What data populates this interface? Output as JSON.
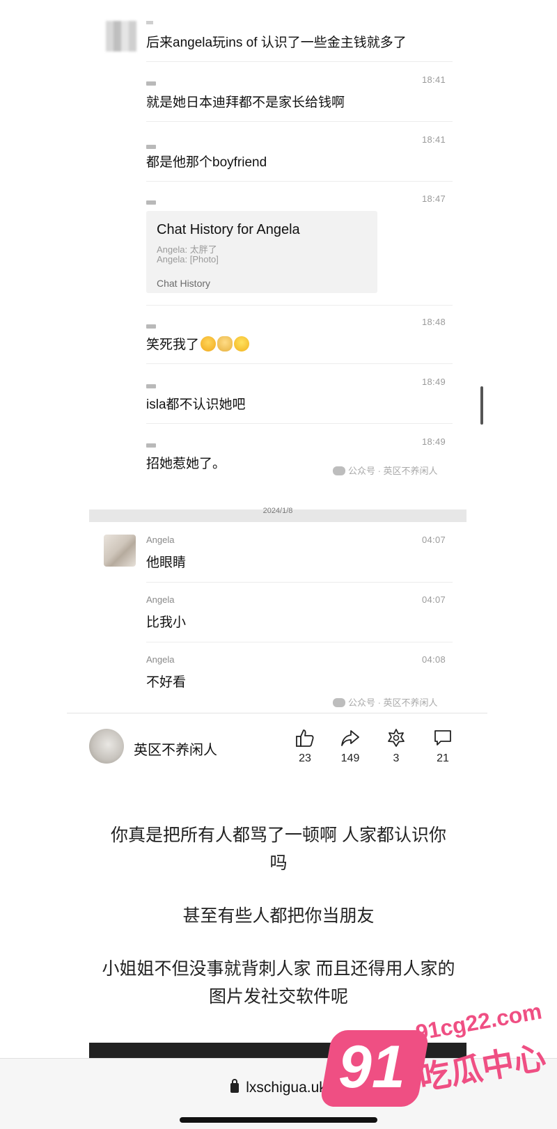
{
  "chat": {
    "messages": [
      {
        "sender": "",
        "time": "",
        "text": "后来angela玩ins of 认识了一些金主钱就多了"
      },
      {
        "sender": "",
        "time": "18:41",
        "text": "就是她日本迪拜都不是家长给钱啊"
      },
      {
        "sender": "",
        "time": "18:41",
        "text": "都是他那个boyfriend"
      },
      {
        "sender": "",
        "time": "18:47",
        "text": ""
      },
      {
        "sender": "",
        "time": "18:48",
        "text": "笑死我了"
      },
      {
        "sender": "",
        "time": "18:49",
        "text": "isla都不认识她吧"
      },
      {
        "sender": "",
        "time": "18:49",
        "text": "招她惹她了。"
      },
      {
        "sender": "Angela",
        "time": "04:07",
        "text": "他眼睛"
      },
      {
        "sender": "Angela",
        "time": "04:07",
        "text": "比我小"
      },
      {
        "sender": "Angela",
        "time": "04:08",
        "text": "不好看"
      }
    ],
    "history_card": {
      "title": "Chat History for Angela",
      "line1": "Angela: 太胖了",
      "line2": "Angela: [Photo]",
      "footer": "Chat History"
    },
    "date_divider": "2024/1/8",
    "watermark": "公众号 · 英区不养闲人"
  },
  "article": {
    "author": "英区不养闲人",
    "actions": [
      {
        "icon": "thumbs-up-icon",
        "count": "23"
      },
      {
        "icon": "share-icon",
        "count": "149"
      },
      {
        "icon": "flower-icon",
        "count": "3"
      },
      {
        "icon": "comment-icon",
        "count": "21"
      }
    ]
  },
  "comments": {
    "p1_line1": "你真是把所有人都骂了一顿啊 人家都认识你",
    "p1_line2": "吗",
    "p2": "甚至有些人都把你当朋友",
    "p3_line1": "小姐姐不但没事就背刺人家 而且还得用人家的",
    "p3_line2": "图片发社交软件呢"
  },
  "browser": {
    "url": "lxschigua.uk"
  },
  "badge": {
    "number": "91",
    "domain": "91cg22.com",
    "name": "吃瓜中心",
    "color": "#ef4f83"
  }
}
